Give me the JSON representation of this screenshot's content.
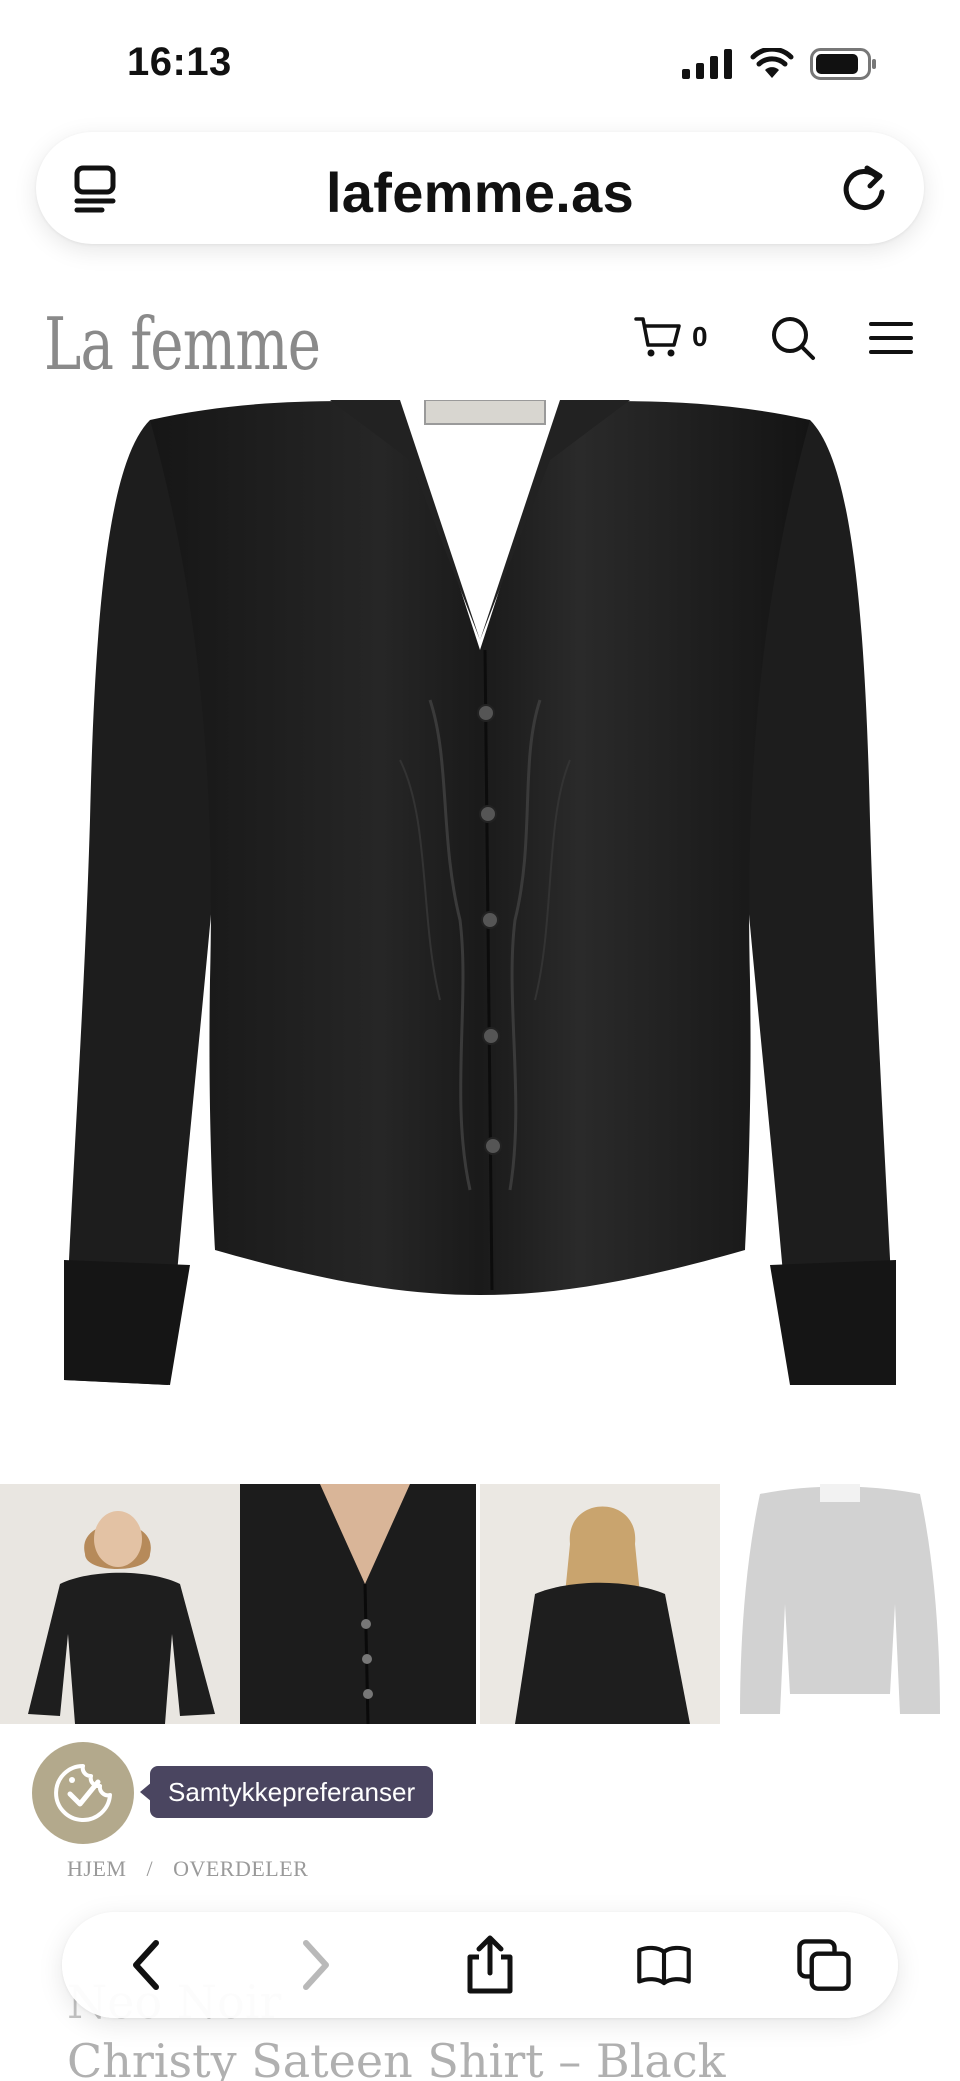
{
  "status_bar": {
    "time": "16:13"
  },
  "browser": {
    "url": "lafemme.as"
  },
  "site": {
    "logo": "La femme",
    "cart_count": "0"
  },
  "consent": {
    "label": "Samtykkepreferanser"
  },
  "breadcrumb": {
    "items": [
      "HJEM",
      "/",
      "OVERDELER"
    ]
  },
  "product": {
    "brand": "Neo Noir",
    "title": "Christy Sateen Shirt – Black"
  },
  "colors": {
    "consent_bg": "#b3a98c",
    "consent_label_bg": "#4a4560"
  }
}
